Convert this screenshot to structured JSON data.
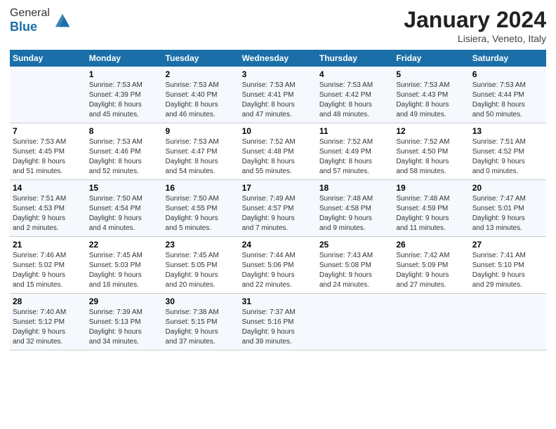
{
  "header": {
    "logo_line1": "General",
    "logo_line2": "Blue",
    "month": "January 2024",
    "location": "Lisiera, Veneto, Italy"
  },
  "days_of_week": [
    "Sunday",
    "Monday",
    "Tuesday",
    "Wednesday",
    "Thursday",
    "Friday",
    "Saturday"
  ],
  "weeks": [
    [
      {
        "day": "",
        "info": ""
      },
      {
        "day": "1",
        "info": "Sunrise: 7:53 AM\nSunset: 4:39 PM\nDaylight: 8 hours\nand 45 minutes."
      },
      {
        "day": "2",
        "info": "Sunrise: 7:53 AM\nSunset: 4:40 PM\nDaylight: 8 hours\nand 46 minutes."
      },
      {
        "day": "3",
        "info": "Sunrise: 7:53 AM\nSunset: 4:41 PM\nDaylight: 8 hours\nand 47 minutes."
      },
      {
        "day": "4",
        "info": "Sunrise: 7:53 AM\nSunset: 4:42 PM\nDaylight: 8 hours\nand 48 minutes."
      },
      {
        "day": "5",
        "info": "Sunrise: 7:53 AM\nSunset: 4:43 PM\nDaylight: 8 hours\nand 49 minutes."
      },
      {
        "day": "6",
        "info": "Sunrise: 7:53 AM\nSunset: 4:44 PM\nDaylight: 8 hours\nand 50 minutes."
      }
    ],
    [
      {
        "day": "7",
        "info": "Sunrise: 7:53 AM\nSunset: 4:45 PM\nDaylight: 8 hours\nand 51 minutes."
      },
      {
        "day": "8",
        "info": "Sunrise: 7:53 AM\nSunset: 4:46 PM\nDaylight: 8 hours\nand 52 minutes."
      },
      {
        "day": "9",
        "info": "Sunrise: 7:53 AM\nSunset: 4:47 PM\nDaylight: 8 hours\nand 54 minutes."
      },
      {
        "day": "10",
        "info": "Sunrise: 7:52 AM\nSunset: 4:48 PM\nDaylight: 8 hours\nand 55 minutes."
      },
      {
        "day": "11",
        "info": "Sunrise: 7:52 AM\nSunset: 4:49 PM\nDaylight: 8 hours\nand 57 minutes."
      },
      {
        "day": "12",
        "info": "Sunrise: 7:52 AM\nSunset: 4:50 PM\nDaylight: 8 hours\nand 58 minutes."
      },
      {
        "day": "13",
        "info": "Sunrise: 7:51 AM\nSunset: 4:52 PM\nDaylight: 9 hours\nand 0 minutes."
      }
    ],
    [
      {
        "day": "14",
        "info": "Sunrise: 7:51 AM\nSunset: 4:53 PM\nDaylight: 9 hours\nand 2 minutes."
      },
      {
        "day": "15",
        "info": "Sunrise: 7:50 AM\nSunset: 4:54 PM\nDaylight: 9 hours\nand 4 minutes."
      },
      {
        "day": "16",
        "info": "Sunrise: 7:50 AM\nSunset: 4:55 PM\nDaylight: 9 hours\nand 5 minutes."
      },
      {
        "day": "17",
        "info": "Sunrise: 7:49 AM\nSunset: 4:57 PM\nDaylight: 9 hours\nand 7 minutes."
      },
      {
        "day": "18",
        "info": "Sunrise: 7:48 AM\nSunset: 4:58 PM\nDaylight: 9 hours\nand 9 minutes."
      },
      {
        "day": "19",
        "info": "Sunrise: 7:48 AM\nSunset: 4:59 PM\nDaylight: 9 hours\nand 11 minutes."
      },
      {
        "day": "20",
        "info": "Sunrise: 7:47 AM\nSunset: 5:01 PM\nDaylight: 9 hours\nand 13 minutes."
      }
    ],
    [
      {
        "day": "21",
        "info": "Sunrise: 7:46 AM\nSunset: 5:02 PM\nDaylight: 9 hours\nand 15 minutes."
      },
      {
        "day": "22",
        "info": "Sunrise: 7:45 AM\nSunset: 5:03 PM\nDaylight: 9 hours\nand 18 minutes."
      },
      {
        "day": "23",
        "info": "Sunrise: 7:45 AM\nSunset: 5:05 PM\nDaylight: 9 hours\nand 20 minutes."
      },
      {
        "day": "24",
        "info": "Sunrise: 7:44 AM\nSunset: 5:06 PM\nDaylight: 9 hours\nand 22 minutes."
      },
      {
        "day": "25",
        "info": "Sunrise: 7:43 AM\nSunset: 5:08 PM\nDaylight: 9 hours\nand 24 minutes."
      },
      {
        "day": "26",
        "info": "Sunrise: 7:42 AM\nSunset: 5:09 PM\nDaylight: 9 hours\nand 27 minutes."
      },
      {
        "day": "27",
        "info": "Sunrise: 7:41 AM\nSunset: 5:10 PM\nDaylight: 9 hours\nand 29 minutes."
      }
    ],
    [
      {
        "day": "28",
        "info": "Sunrise: 7:40 AM\nSunset: 5:12 PM\nDaylight: 9 hours\nand 32 minutes."
      },
      {
        "day": "29",
        "info": "Sunrise: 7:39 AM\nSunset: 5:13 PM\nDaylight: 9 hours\nand 34 minutes."
      },
      {
        "day": "30",
        "info": "Sunrise: 7:38 AM\nSunset: 5:15 PM\nDaylight: 9 hours\nand 37 minutes."
      },
      {
        "day": "31",
        "info": "Sunrise: 7:37 AM\nSunset: 5:16 PM\nDaylight: 9 hours\nand 39 minutes."
      },
      {
        "day": "",
        "info": ""
      },
      {
        "day": "",
        "info": ""
      },
      {
        "day": "",
        "info": ""
      }
    ]
  ]
}
